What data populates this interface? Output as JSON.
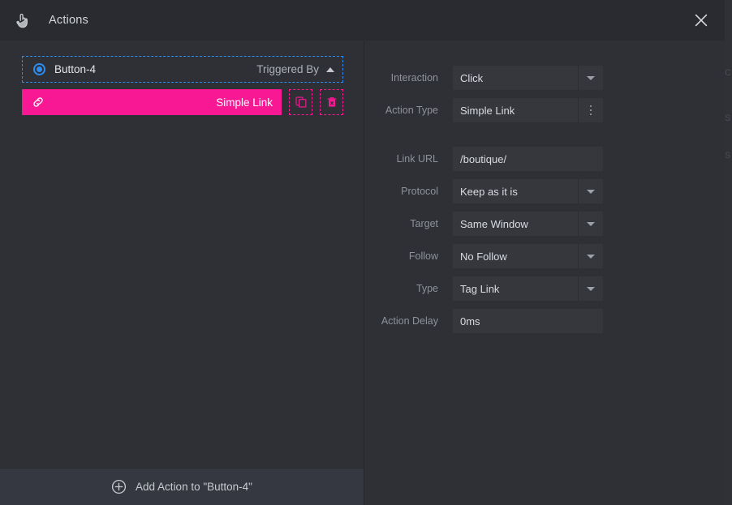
{
  "header": {
    "icon": "hand-pointer-icon",
    "title": "Actions",
    "close_label": "×"
  },
  "left_pane": {
    "trigger": {
      "radio_name": "radio-selected-icon",
      "name": "Button-4",
      "triggered_by_label": "Triggered By",
      "chevron": "chevron-up-icon",
      "border_color": "#2d8cf0"
    },
    "action": {
      "icon": "link-icon",
      "label": "Simple Link",
      "color": "#f81894",
      "duplicate_icon": "copy-icon",
      "delete_icon": "trash-icon"
    },
    "add_action_label": "Add Action to \"Button-4\"",
    "add_action_icon": "plus-circle-icon"
  },
  "right_pane": {
    "fields": [
      {
        "label": "Interaction",
        "value": "Click",
        "control": "select"
      },
      {
        "label": "Action Type",
        "value": "Simple Link",
        "control": "kebab"
      },
      {
        "label": "Link URL",
        "value": "/boutique/",
        "control": "text"
      },
      {
        "label": "Protocol",
        "value": "Keep as it is",
        "control": "select"
      },
      {
        "label": "Target",
        "value": "Same Window",
        "control": "select"
      },
      {
        "label": "Follow",
        "value": "No Follow",
        "control": "select"
      },
      {
        "label": "Type",
        "value": "Tag Link",
        "control": "select"
      },
      {
        "label": "Action Delay",
        "value": "0ms",
        "control": "text"
      }
    ]
  },
  "background_strip": {
    "ghost_fragments": [
      "C",
      "S",
      "S"
    ]
  },
  "colors": {
    "modal_bg": "#2e3036",
    "header_bg": "#292b30",
    "field_bg": "#35373d",
    "accent_pink": "#f81894",
    "accent_blue": "#2d8cf0",
    "footer_bg": "#353840"
  }
}
